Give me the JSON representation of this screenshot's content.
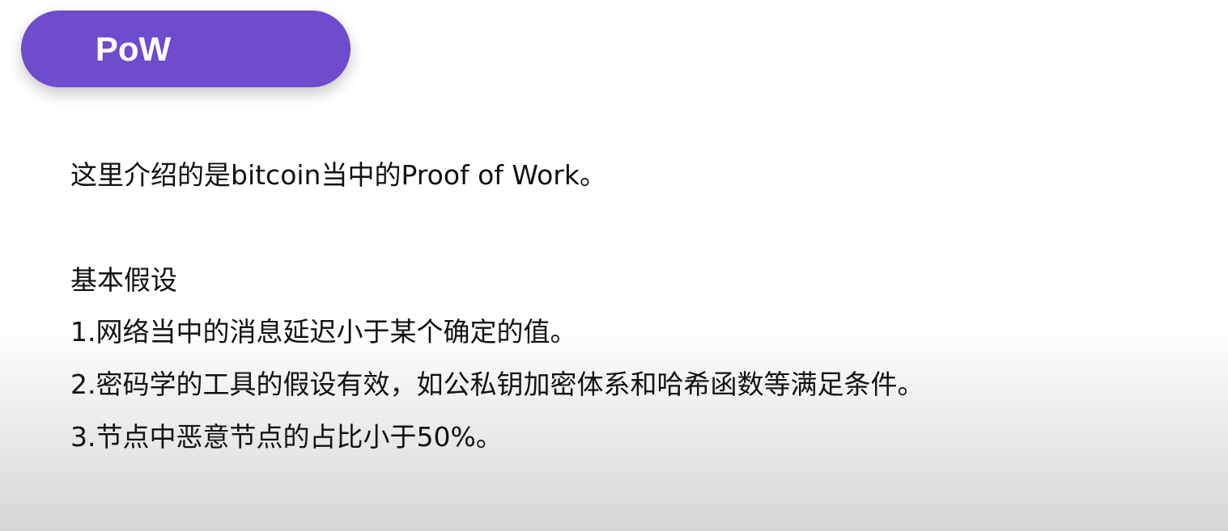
{
  "slide": {
    "title": "PoW",
    "intro": "这里介绍的是bitcoin当中的Proof of Work。",
    "assumptions_heading": "基本假设",
    "assumptions": [
      "1.网络当中的消息延迟小于某个确定的值。",
      "2.密码学的工具的假设有效，如公私钥加密体系和哈希函数等满足条件。",
      "3.节点中恶意节点的占比小于50%。"
    ]
  },
  "colors": {
    "title_pill_background": "#6f4bcd",
    "title_text": "#ffffff",
    "body_text": "#111111"
  }
}
